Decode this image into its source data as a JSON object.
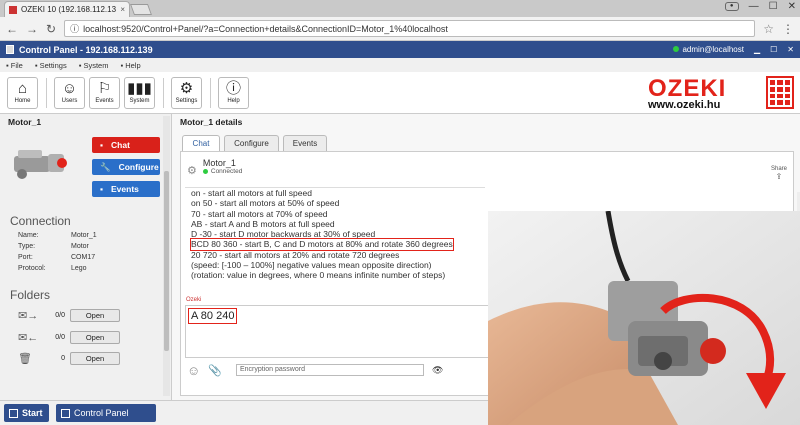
{
  "browser": {
    "tab_title": "OZEKI 10 (192.168.112.13",
    "tab_close": "×",
    "url": "localhost:9520/Control+Panel/?a=Connection+details&ConnectionID=Motor_1%40localhost",
    "win_min": "—",
    "win_max": "☐",
    "win_close": "✕"
  },
  "app": {
    "title": "Control Panel - 192.168.112.139",
    "user": "admin@localhost",
    "menu": [
      "File",
      "Settings",
      "System",
      "Help"
    ],
    "toolbar": [
      {
        "label": "Home",
        "icon": "home-icon"
      },
      {
        "label": "Users",
        "icon": "user-icon"
      },
      {
        "label": "Events",
        "icon": "flag-icon"
      },
      {
        "label": "System",
        "icon": "bars-icon"
      },
      {
        "label": "Settings",
        "icon": "gear-icon"
      },
      {
        "label": "Help",
        "icon": "info-icon"
      }
    ],
    "logo_text": "OZEKI",
    "logo_url": "www.ozeki.hu"
  },
  "left": {
    "title": "Motor_1",
    "buttons": {
      "chat": "Chat",
      "configure": "Configure",
      "events": "Events"
    },
    "connection_heading": "Connection",
    "connection": [
      {
        "k": "Name:",
        "v": "Motor_1"
      },
      {
        "k": "Type:",
        "v": "Motor"
      },
      {
        "k": "Port:",
        "v": "COM17"
      },
      {
        "k": "Protocol:",
        "v": "Lego"
      }
    ],
    "folders_heading": "Folders",
    "folders": [
      {
        "count": "0/0",
        "open": "Open",
        "icon": "inbox-icon"
      },
      {
        "count": "0/0",
        "open": "Open",
        "icon": "outbox-icon"
      },
      {
        "count": "0",
        "open": "Open",
        "icon": "trash-icon"
      }
    ]
  },
  "main": {
    "title": "Motor_1 details",
    "tabs": [
      "Chat",
      "Configure",
      "Events"
    ],
    "device_name": "Motor_1",
    "device_status": "Connected",
    "share_label": "Share",
    "messages": [
      "on - start all motors at full speed",
      "on 50 - start all motors at 50% of speed",
      "70 - start all motors at 70% of speed",
      "AB - start A and B motors at full speed",
      "D -30 - start D motor backwards at 30% of speed",
      "BCD 80 360 - start B, C and D motors at 80% and rotate 360 degrees",
      "20 720 - start all motors at 20% and rotate 720 degrees",
      "(speed: [-100 – 100%] negative values mean opposite direction)",
      "(rotation: value in degrees, where 0 means infinite number of steps)"
    ],
    "input_label": "Ozeki",
    "input_value": "A 80 240",
    "encryption_placeholder": "Encryption password"
  },
  "taskbar": {
    "start": "Start",
    "control_panel": "Control Panel"
  }
}
